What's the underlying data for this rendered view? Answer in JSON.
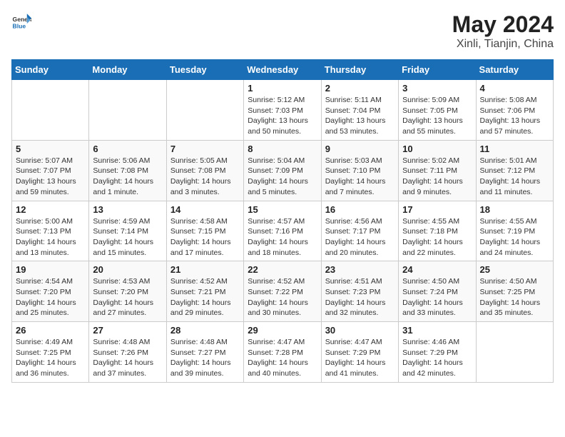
{
  "app": {
    "logo_general": "General",
    "logo_blue": "Blue",
    "title": "May 2024",
    "location": "Xinli, Tianjin, China"
  },
  "calendar": {
    "headers": [
      "Sunday",
      "Monday",
      "Tuesday",
      "Wednesday",
      "Thursday",
      "Friday",
      "Saturday"
    ],
    "weeks": [
      [
        {
          "day": "",
          "info": ""
        },
        {
          "day": "",
          "info": ""
        },
        {
          "day": "",
          "info": ""
        },
        {
          "day": "1",
          "info": "Sunrise: 5:12 AM\nSunset: 7:03 PM\nDaylight: 13 hours\nand 50 minutes."
        },
        {
          "day": "2",
          "info": "Sunrise: 5:11 AM\nSunset: 7:04 PM\nDaylight: 13 hours\nand 53 minutes."
        },
        {
          "day": "3",
          "info": "Sunrise: 5:09 AM\nSunset: 7:05 PM\nDaylight: 13 hours\nand 55 minutes."
        },
        {
          "day": "4",
          "info": "Sunrise: 5:08 AM\nSunset: 7:06 PM\nDaylight: 13 hours\nand 57 minutes."
        }
      ],
      [
        {
          "day": "5",
          "info": "Sunrise: 5:07 AM\nSunset: 7:07 PM\nDaylight: 13 hours\nand 59 minutes."
        },
        {
          "day": "6",
          "info": "Sunrise: 5:06 AM\nSunset: 7:08 PM\nDaylight: 14 hours\nand 1 minute."
        },
        {
          "day": "7",
          "info": "Sunrise: 5:05 AM\nSunset: 7:08 PM\nDaylight: 14 hours\nand 3 minutes."
        },
        {
          "day": "8",
          "info": "Sunrise: 5:04 AM\nSunset: 7:09 PM\nDaylight: 14 hours\nand 5 minutes."
        },
        {
          "day": "9",
          "info": "Sunrise: 5:03 AM\nSunset: 7:10 PM\nDaylight: 14 hours\nand 7 minutes."
        },
        {
          "day": "10",
          "info": "Sunrise: 5:02 AM\nSunset: 7:11 PM\nDaylight: 14 hours\nand 9 minutes."
        },
        {
          "day": "11",
          "info": "Sunrise: 5:01 AM\nSunset: 7:12 PM\nDaylight: 14 hours\nand 11 minutes."
        }
      ],
      [
        {
          "day": "12",
          "info": "Sunrise: 5:00 AM\nSunset: 7:13 PM\nDaylight: 14 hours\nand 13 minutes."
        },
        {
          "day": "13",
          "info": "Sunrise: 4:59 AM\nSunset: 7:14 PM\nDaylight: 14 hours\nand 15 minutes."
        },
        {
          "day": "14",
          "info": "Sunrise: 4:58 AM\nSunset: 7:15 PM\nDaylight: 14 hours\nand 17 minutes."
        },
        {
          "day": "15",
          "info": "Sunrise: 4:57 AM\nSunset: 7:16 PM\nDaylight: 14 hours\nand 18 minutes."
        },
        {
          "day": "16",
          "info": "Sunrise: 4:56 AM\nSunset: 7:17 PM\nDaylight: 14 hours\nand 20 minutes."
        },
        {
          "day": "17",
          "info": "Sunrise: 4:55 AM\nSunset: 7:18 PM\nDaylight: 14 hours\nand 22 minutes."
        },
        {
          "day": "18",
          "info": "Sunrise: 4:55 AM\nSunset: 7:19 PM\nDaylight: 14 hours\nand 24 minutes."
        }
      ],
      [
        {
          "day": "19",
          "info": "Sunrise: 4:54 AM\nSunset: 7:20 PM\nDaylight: 14 hours\nand 25 minutes."
        },
        {
          "day": "20",
          "info": "Sunrise: 4:53 AM\nSunset: 7:20 PM\nDaylight: 14 hours\nand 27 minutes."
        },
        {
          "day": "21",
          "info": "Sunrise: 4:52 AM\nSunset: 7:21 PM\nDaylight: 14 hours\nand 29 minutes."
        },
        {
          "day": "22",
          "info": "Sunrise: 4:52 AM\nSunset: 7:22 PM\nDaylight: 14 hours\nand 30 minutes."
        },
        {
          "day": "23",
          "info": "Sunrise: 4:51 AM\nSunset: 7:23 PM\nDaylight: 14 hours\nand 32 minutes."
        },
        {
          "day": "24",
          "info": "Sunrise: 4:50 AM\nSunset: 7:24 PM\nDaylight: 14 hours\nand 33 minutes."
        },
        {
          "day": "25",
          "info": "Sunrise: 4:50 AM\nSunset: 7:25 PM\nDaylight: 14 hours\nand 35 minutes."
        }
      ],
      [
        {
          "day": "26",
          "info": "Sunrise: 4:49 AM\nSunset: 7:25 PM\nDaylight: 14 hours\nand 36 minutes."
        },
        {
          "day": "27",
          "info": "Sunrise: 4:48 AM\nSunset: 7:26 PM\nDaylight: 14 hours\nand 37 minutes."
        },
        {
          "day": "28",
          "info": "Sunrise: 4:48 AM\nSunset: 7:27 PM\nDaylight: 14 hours\nand 39 minutes."
        },
        {
          "day": "29",
          "info": "Sunrise: 4:47 AM\nSunset: 7:28 PM\nDaylight: 14 hours\nand 40 minutes."
        },
        {
          "day": "30",
          "info": "Sunrise: 4:47 AM\nSunset: 7:29 PM\nDaylight: 14 hours\nand 41 minutes."
        },
        {
          "day": "31",
          "info": "Sunrise: 4:46 AM\nSunset: 7:29 PM\nDaylight: 14 hours\nand 42 minutes."
        },
        {
          "day": "",
          "info": ""
        }
      ]
    ]
  }
}
